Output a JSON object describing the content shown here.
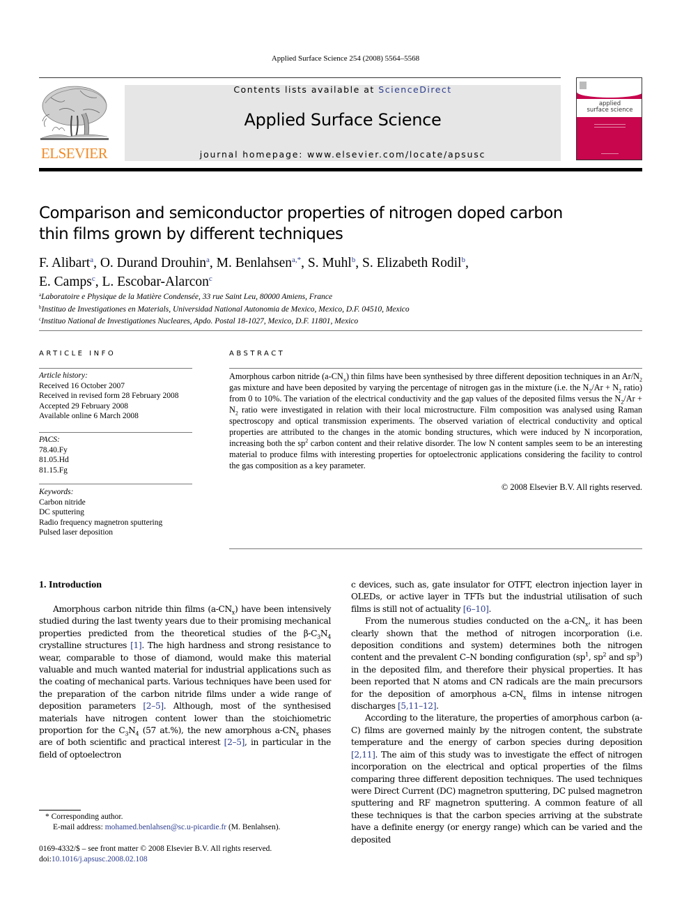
{
  "running_head": "Applied Surface Science 254 (2008) 5564–5568",
  "masthead": {
    "publisher_logo_text": "ELSEVIER",
    "contents_prefix": "Contents lists available at ",
    "contents_link": "ScienceDirect",
    "journal_title": "Applied Surface Science",
    "homepage_prefix": "journal homepage: ",
    "homepage_url": "www.elsevier.com/locate/apsusc",
    "cover_title_line1": "applied",
    "cover_title_line2": "surface science",
    "colors": {
      "publisher_orange": "#f28a26",
      "cover_magenta": "#c7064e",
      "link_blue": "#2c3d8f",
      "masthead_gray": "#e6e6e6"
    }
  },
  "article": {
    "title": "Comparison and semiconductor properties of nitrogen doped carbon thin films grown by different techniques",
    "authors": [
      {
        "name": "F. Alibart",
        "aff": "a",
        "sep": ", "
      },
      {
        "name": "O. Durand Drouhin",
        "aff": "a",
        "sep": ", "
      },
      {
        "name": "M. Benlahsen",
        "aff": "a,*",
        "sep": ", "
      },
      {
        "name": "S. Muhl",
        "aff": "b",
        "sep": ", "
      },
      {
        "name": "S. Elizabeth Rodil",
        "aff": "b",
        "sep": ","
      },
      {
        "name": "E. Camps",
        "aff": "c",
        "sep": ", "
      },
      {
        "name": "L. Escobar-Alarcon",
        "aff": "c",
        "sep": ""
      }
    ],
    "affiliations": [
      {
        "key": "a",
        "text": "Laboratoire e Physique de la Matière Condensée, 33 rue Saint Leu, 80000 Amiens, France"
      },
      {
        "key": "b",
        "text": "Instituo de Investigationes en Materials, Universidad National Autonomia de Mexico, Mexico, D.F. 04510, Mexico"
      },
      {
        "key": "c",
        "text": "Instituo National de Investigationes Nucleares, Apdo. Postal 18-1027, Mexico, D.F. 11801, Mexico"
      }
    ]
  },
  "article_info": {
    "heading": "ARTICLE INFO",
    "history_label": "Article history:",
    "history": [
      "Received 16 October 2007",
      "Received in revised form 28 February 2008",
      "Accepted 29 February 2008",
      "Available online 6 March 2008"
    ],
    "pacs_label": "PACS:",
    "pacs": [
      "78.40.Fy",
      "81.05.Hd",
      "81.15.Fg"
    ],
    "keywords_label": "Keywords:",
    "keywords": [
      "Carbon nitride",
      "DC sputtering",
      "Radio frequency magnetron sputtering",
      "Pulsed laser deposition"
    ]
  },
  "abstract": {
    "heading": "ABSTRACT",
    "segments": {
      "s1": "Amorphous carbon nitride (a-CN",
      "s1_sub": "x",
      "s2": ") thin films have been synthesised by three different deposition techniques in an Ar/N",
      "s2_sub": "2",
      "s3": " gas mixture and have been deposited by varying the percentage of nitrogen gas in the mixture (i.e. the N",
      "s3_sub": "2",
      "s4": "/Ar + N",
      "s4_sub": "2",
      "s5": " ratio) from 0 to 10%. The variation of the electrical conductivity and the gap values of the deposited films versus the N",
      "s5_sub": "2",
      "s6": "/Ar + N",
      "s6_sub": "2",
      "s7": " ratio were investigated in relation with their local microstructure. Film composition was analysed using Raman spectroscopy and optical transmission experiments. The observed variation of electrical conductivity and optical properties are attributed to the changes in the atomic bonding structures, which were induced by N incorporation, increasing both the sp",
      "s7_sup": "2",
      "s8": " carbon content and their relative disorder. The low N content samples seem to be an interesting material to produce films with interesting properties for optoelectronic applications considering the facility to control the gas composition as a key parameter."
    },
    "copyright": "© 2008 Elsevier B.V. All rights reserved."
  },
  "introduction": {
    "heading": "1.  Introduction",
    "p1": {
      "a": "Amorphous carbon nitride thin films (a-CN",
      "a_sub": "x",
      "b": ") have been intensively studied during the last twenty years due to their promising mechanical properties predicted from the theoretical studies of the β-C",
      "b_sub": "3",
      "c": "N",
      "c_sub": "4",
      "d": " crystalline structures ",
      "ref1": "[1]",
      "e": ". The high hardness and strong resistance to wear, comparable to those of diamond, would make this material valuable and much wanted material for industrial applications such as the coating of mechanical parts. Various techniques have been used for the preparation of the carbon nitride films under a wide range of deposition parameters ",
      "ref2": "[2–5]",
      "f": ". Although, most of the synthesised materials have nitrogen content lower than the stoichiometric proportion for the C",
      "f_sub": "3",
      "g": "N",
      "g_sub": "4",
      "h": " (57 at.%), the new amorphous a-CN",
      "h_sub": "x",
      "i": " phases are of both scientific and practical interest ",
      "ref3": "[2–5]",
      "j": ", in particular in the field of optoelectronic devices, such as, gate insulator for OTFT, electron injection layer in OLEDs, or active layer in TFTs but the industrial utilisation of such films is still not of actuality ",
      "ref4": "[6–10]",
      "k": "."
    },
    "p2": {
      "a": "From the numerous studies conducted on the a-CN",
      "a_sub": "x",
      "b": ", it has been clearly shown that the method of nitrogen incorporation (i.e. deposition conditions and system) determines both the nitrogen content and the prevalent C–N bonding configuration (sp",
      "b_sup": "1",
      "c": ", sp",
      "c_sup": "2",
      "d": " and sp",
      "d_sup": "3",
      "e": ") in the deposited film, and therefore their physical properties. It has been reported that N atoms and CN radicals are the main precursors for the deposition of amorphous a-CN",
      "e_sub": "x",
      "f": " films in intense nitrogen discharges ",
      "ref": "[5,11–12]",
      "g": "."
    },
    "p3": {
      "a": "According to the literature, the properties of amorphous carbon (a-C) films are governed mainly by the nitrogen content, the substrate temperature and the energy of carbon species during deposition ",
      "ref": "[2,11]",
      "b": ". The aim of this study was to investigate the effect of nitrogen incorporation on the electrical and optical properties of the films comparing three different deposition techniques. The used techniques were Direct Current (DC) magnetron sputtering, DC pulsed magnetron sputtering and RF magnetron sputtering. A common feature of all these techniques is that the carbon species arriving at the substrate have a definite energy (or energy range) which can be varied and the deposited"
    }
  },
  "footnote": {
    "star": "*",
    "corresponding": " Corresponding author.",
    "email_label": "E-mail address: ",
    "email": "mohamed.benlahsen@sc.u-picardie.fr",
    "email_owner": " (M. Benlahsen)."
  },
  "front_matter": {
    "issn_line": "0169-4332/$ – see front matter © 2008 Elsevier B.V. All rights reserved.",
    "doi_label": "doi:",
    "doi": "10.1016/j.apsusc.2008.02.108"
  }
}
